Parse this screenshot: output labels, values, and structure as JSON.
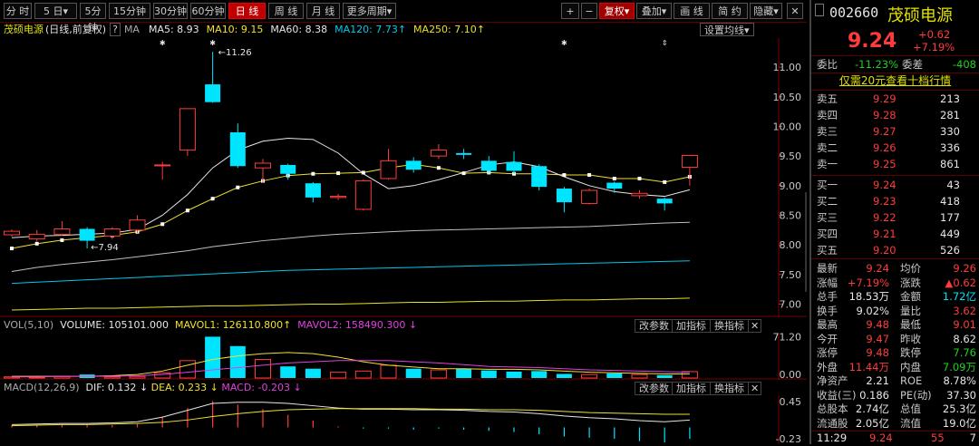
{
  "toolbar": {
    "periods": [
      "分 时",
      "5 日▾",
      "5分钟",
      "15分钟",
      "30分钟",
      "60分钟",
      "日 线",
      "周 线",
      "月 线",
      "更多周期▾"
    ],
    "active_period": "日 线",
    "right_buttons": [
      "+",
      "−",
      "复权▾",
      "叠加▾",
      "画 线",
      "简 约",
      "隐藏▾"
    ]
  },
  "header": {
    "stock": "茂硕电源",
    "mode": "(日线,前复权)",
    "help": "?",
    "ma_label": "MA",
    "ma5": "MA5: 8.93",
    "ma10": "MA10: 9.15",
    "ma60": "MA60: 8.38",
    "ma120": "MA120: 7.73",
    "ma250": "MA250: 7.10",
    "arrow": "↑",
    "settings": "设置均线▾"
  },
  "colors": {
    "up": "#ff3b3b",
    "down": "#00e5ff",
    "ma5": "#e6e6e6",
    "ma10": "#f0e030",
    "ma60": "#c0c0c0",
    "ma120": "#00c8e8",
    "ma250": "#e8e020",
    "mavol2": "#e040e0"
  },
  "chart_data": [
    {
      "type": "candlestick",
      "title": "茂硕电源 (日线,前复权)",
      "ylim": [
        6.9,
        11.4
      ],
      "y_ticks": [
        "11.00",
        "10.50",
        "10.00",
        "9.50",
        "9.00",
        "8.50",
        "8.00",
        "7.50",
        "7.00"
      ],
      "annotations": [
        "11.26",
        "7.94"
      ],
      "candles": [
        {
          "o": 8.17,
          "c": 8.23,
          "h": 8.26,
          "l": 8.14
        },
        {
          "o": 8.1,
          "c": 8.18,
          "h": 8.25,
          "l": 8.06
        },
        {
          "o": 8.18,
          "c": 8.27,
          "h": 8.4,
          "l": 8.15
        },
        {
          "o": 8.27,
          "c": 8.07,
          "h": 8.3,
          "l": 7.94
        },
        {
          "o": 8.15,
          "c": 8.27,
          "h": 8.3,
          "l": 8.1
        },
        {
          "o": 8.25,
          "c": 8.42,
          "h": 8.5,
          "l": 8.2
        },
        {
          "o": 9.35,
          "c": 9.35,
          "h": 9.4,
          "l": 9.1
        },
        {
          "o": 9.6,
          "c": 10.3,
          "h": 10.3,
          "l": 9.5
        },
        {
          "o": 10.71,
          "c": 10.41,
          "h": 11.26,
          "l": 10.4
        },
        {
          "o": 9.9,
          "c": 9.33,
          "h": 10.05,
          "l": 9.3
        },
        {
          "o": 9.3,
          "c": 9.38,
          "h": 9.45,
          "l": 9.05
        },
        {
          "o": 9.35,
          "c": 9.2,
          "h": 9.37,
          "l": 9.1
        },
        {
          "o": 9.04,
          "c": 8.8,
          "h": 9.06,
          "l": 8.72
        },
        {
          "o": 8.8,
          "c": 8.82,
          "h": 8.86,
          "l": 8.76
        },
        {
          "o": 8.6,
          "c": 9.08,
          "h": 9.1,
          "l": 8.58
        },
        {
          "o": 9.12,
          "c": 9.42,
          "h": 9.62,
          "l": 9.1
        },
        {
          "o": 9.42,
          "c": 9.27,
          "h": 9.48,
          "l": 9.22
        },
        {
          "o": 9.5,
          "c": 9.6,
          "h": 9.7,
          "l": 9.45
        },
        {
          "o": 9.55,
          "c": 9.52,
          "h": 9.62,
          "l": 9.45
        },
        {
          "o": 9.42,
          "c": 9.25,
          "h": 9.5,
          "l": 9.2
        },
        {
          "o": 9.4,
          "c": 9.25,
          "h": 9.58,
          "l": 9.2
        },
        {
          "o": 9.33,
          "c": 8.98,
          "h": 9.36,
          "l": 8.92
        },
        {
          "o": 8.95,
          "c": 8.72,
          "h": 8.98,
          "l": 8.55
        },
        {
          "o": 8.7,
          "c": 8.92,
          "h": 8.95,
          "l": 8.68
        },
        {
          "o": 9.05,
          "c": 8.95,
          "h": 9.07,
          "l": 8.88
        },
        {
          "o": 8.83,
          "c": 8.87,
          "h": 8.92,
          "l": 8.78
        },
        {
          "o": 8.78,
          "c": 8.7,
          "h": 8.8,
          "l": 8.58
        },
        {
          "o": 9.31,
          "c": 9.51,
          "h": 9.51,
          "l": 9.0
        }
      ],
      "ma5": [
        8.12,
        8.15,
        8.16,
        8.18,
        8.2,
        8.26,
        8.5,
        8.85,
        9.3,
        9.6,
        9.75,
        9.8,
        9.78,
        9.55,
        9.2,
        8.95,
        9.0,
        9.1,
        9.22,
        9.35,
        9.4,
        9.32,
        9.15,
        9.0,
        8.9,
        8.85,
        8.82,
        8.93
      ],
      "ma10": [
        7.94,
        8.02,
        8.08,
        8.12,
        8.16,
        8.22,
        8.35,
        8.58,
        8.78,
        8.97,
        9.08,
        9.17,
        9.2,
        9.21,
        9.22,
        9.3,
        9.36,
        9.3,
        9.21,
        9.22,
        9.2,
        9.2,
        9.18,
        9.18,
        9.12,
        9.12,
        9.06,
        9.15
      ],
      "ma60": [
        7.55,
        7.62,
        7.67,
        7.71,
        7.75,
        7.8,
        7.85,
        7.9,
        7.97,
        8.02,
        8.07,
        8.11,
        8.15,
        8.18,
        8.2,
        8.22,
        8.24,
        8.25,
        8.26,
        8.27,
        8.28,
        8.29,
        8.3,
        8.31,
        8.33,
        8.35,
        8.37,
        8.38
      ],
      "ma120": [
        7.35,
        7.37,
        7.39,
        7.41,
        7.43,
        7.45,
        7.47,
        7.49,
        7.51,
        7.53,
        7.55,
        7.57,
        7.58,
        7.59,
        7.6,
        7.61,
        7.62,
        7.63,
        7.64,
        7.65,
        7.66,
        7.67,
        7.68,
        7.69,
        7.7,
        7.71,
        7.72,
        7.73
      ],
      "ma250": [
        6.9,
        6.91,
        6.92,
        6.93,
        6.93,
        6.94,
        6.95,
        6.96,
        6.97,
        6.97,
        6.98,
        6.99,
        7.0,
        7.0,
        7.01,
        7.02,
        7.03,
        7.03,
        7.04,
        7.05,
        7.05,
        7.06,
        7.07,
        7.07,
        7.08,
        7.09,
        7.09,
        7.1
      ]
    },
    {
      "type": "bar",
      "title": "VOL(5,10)",
      "ylim": [
        0,
        75
      ],
      "y_ticks": [
        "71.20",
        "0.00"
      ],
      "volume": [
        2,
        1.5,
        2.5,
        6,
        2.2,
        2.8,
        9,
        30,
        71.2,
        55,
        32,
        20,
        16,
        10,
        12,
        22,
        16,
        14,
        16,
        13,
        11,
        12,
        7,
        6,
        8,
        6,
        5,
        11
      ],
      "mavol1": [
        3,
        3,
        3,
        3,
        4,
        6,
        12,
        22,
        32,
        38,
        42,
        44,
        42,
        36,
        28,
        22,
        19,
        16,
        16,
        15,
        15,
        14,
        12,
        10,
        9,
        8,
        7,
        7
      ],
      "mavol2": [
        2,
        2,
        3,
        3,
        3,
        4,
        6,
        10,
        14,
        18,
        22,
        26,
        28,
        30,
        30,
        30,
        28,
        26,
        23,
        20,
        19,
        18,
        16,
        14,
        13,
        12,
        11,
        10
      ]
    },
    {
      "type": "line",
      "title": "MACD(12,26,9)",
      "ylim": [
        -0.23,
        0.5
      ],
      "y_ticks": [
        "0.45",
        "-0.23"
      ],
      "dif": [
        0.05,
        0.06,
        0.07,
        0.07,
        0.08,
        0.1,
        0.18,
        0.3,
        0.42,
        0.44,
        0.44,
        0.42,
        0.38,
        0.34,
        0.32,
        0.32,
        0.31,
        0.31,
        0.3,
        0.28,
        0.27,
        0.24,
        0.2,
        0.17,
        0.15,
        0.12,
        0.1,
        0.13
      ],
      "dea": [
        0.03,
        0.04,
        0.05,
        0.05,
        0.06,
        0.07,
        0.09,
        0.13,
        0.19,
        0.24,
        0.28,
        0.31,
        0.32,
        0.33,
        0.33,
        0.33,
        0.33,
        0.32,
        0.32,
        0.31,
        0.31,
        0.3,
        0.28,
        0.26,
        0.25,
        0.24,
        0.23,
        0.23
      ],
      "macd": [
        0.04,
        0.04,
        0.04,
        0.04,
        0.04,
        0.06,
        0.18,
        0.34,
        0.46,
        0.4,
        0.32,
        0.22,
        0.12,
        0.02,
        -0.02,
        -0.02,
        -0.04,
        -0.02,
        -0.04,
        -0.06,
        -0.08,
        -0.12,
        -0.16,
        -0.18,
        -0.2,
        -0.24,
        -0.26,
        -0.2
      ]
    }
  ],
  "vol_pane": {
    "label": "VOL(5,10)",
    "volume": "VOLUME: 105101.000",
    "mavol1": "MAVOL1: 126110.800",
    "mavol2": "MAVOL2: 158490.300",
    "arrow1": "↑",
    "arrow2": "↓",
    "btn_params": "改参数",
    "btn_add": "加指标",
    "btn_swap": "换指标",
    "close": "✕"
  },
  "macd_pane": {
    "label": "MACD(12,26,9)",
    "dif": "DIF: 0.132",
    "dea": "DEA: 0.233",
    "macd": "MACD: -0.203",
    "arrow_dif": "↓",
    "arrow_dea": "↓",
    "arrow_macd": "↓",
    "btn_params": "改参数",
    "btn_add": "加指标",
    "btn_swap": "换指标",
    "close": "✕"
  },
  "panel": {
    "code": "002660",
    "name": "茂硕电源",
    "price": "9.24",
    "change": "+0.62",
    "change_pct": "+7.19%",
    "weibi_label": "委比",
    "weibi": "-11.23%",
    "weicha_label": "委差",
    "weicha": "-408",
    "promo": "仅需20元查看十档行情",
    "asks": [
      {
        "label": "卖五",
        "price": "9.29",
        "vol": "213"
      },
      {
        "label": "卖四",
        "price": "9.28",
        "vol": "281"
      },
      {
        "label": "卖三",
        "price": "9.27",
        "vol": "330"
      },
      {
        "label": "卖二",
        "price": "9.26",
        "vol": "336"
      },
      {
        "label": "卖一",
        "price": "9.25",
        "vol": "861"
      }
    ],
    "bids": [
      {
        "label": "买一",
        "price": "9.24",
        "vol": "43"
      },
      {
        "label": "买二",
        "price": "9.23",
        "vol": "418"
      },
      {
        "label": "买三",
        "price": "9.22",
        "vol": "177"
      },
      {
        "label": "买四",
        "price": "9.21",
        "vol": "449"
      },
      {
        "label": "买五",
        "price": "9.20",
        "vol": "526"
      }
    ],
    "stats": [
      {
        "l1": "最新",
        "v1": "9.24",
        "c1": "red",
        "l2": "均价",
        "v2": "9.26",
        "c2": "red"
      },
      {
        "l1": "涨幅",
        "v1": "+7.19%",
        "c1": "red",
        "l2": "涨跌",
        "v2": "▲0.62",
        "c2": "red"
      },
      {
        "l1": "总手",
        "v1": "18.53万",
        "c1": "white",
        "l2": "金额",
        "v2": "1.72亿",
        "c2": "cyan"
      },
      {
        "l1": "换手",
        "v1": "9.02%",
        "c1": "white",
        "l2": "量比",
        "v2": "3.62",
        "c2": "red"
      },
      {
        "l1": "最高",
        "v1": "9.48",
        "c1": "red",
        "l2": "最低",
        "v2": "9.01",
        "c2": "red"
      },
      {
        "l1": "今开",
        "v1": "9.47",
        "c1": "red",
        "l2": "昨收",
        "v2": "8.62",
        "c2": "white"
      },
      {
        "l1": "涨停",
        "v1": "9.48",
        "c1": "red",
        "l2": "跌停",
        "v2": "7.76",
        "c2": "green"
      },
      {
        "l1": "外盘",
        "v1": "11.44万",
        "c1": "red",
        "l2": "内盘",
        "v2": "7.09万",
        "c2": "green"
      },
      {
        "l1": "净资产",
        "v1": "2.21",
        "c1": "white",
        "l2": "ROE",
        "v2": "8.78%",
        "c2": "white"
      },
      {
        "l1": "收益(三)",
        "v1": "0.186",
        "c1": "white",
        "l2": "PE(动)",
        "v2": "37.30",
        "c2": "white"
      },
      {
        "l1": "总股本",
        "v1": "2.74亿",
        "c1": "white",
        "l2": "总值",
        "v2": "25.3亿",
        "c2": "white"
      },
      {
        "l1": "流通股",
        "v1": "2.05亿",
        "c1": "white",
        "l2": "流值",
        "v2": "19.0亿",
        "c2": "white"
      }
    ],
    "tick": {
      "time": "11:29",
      "price": "9.24",
      "vol": "55",
      "num": "7"
    }
  }
}
